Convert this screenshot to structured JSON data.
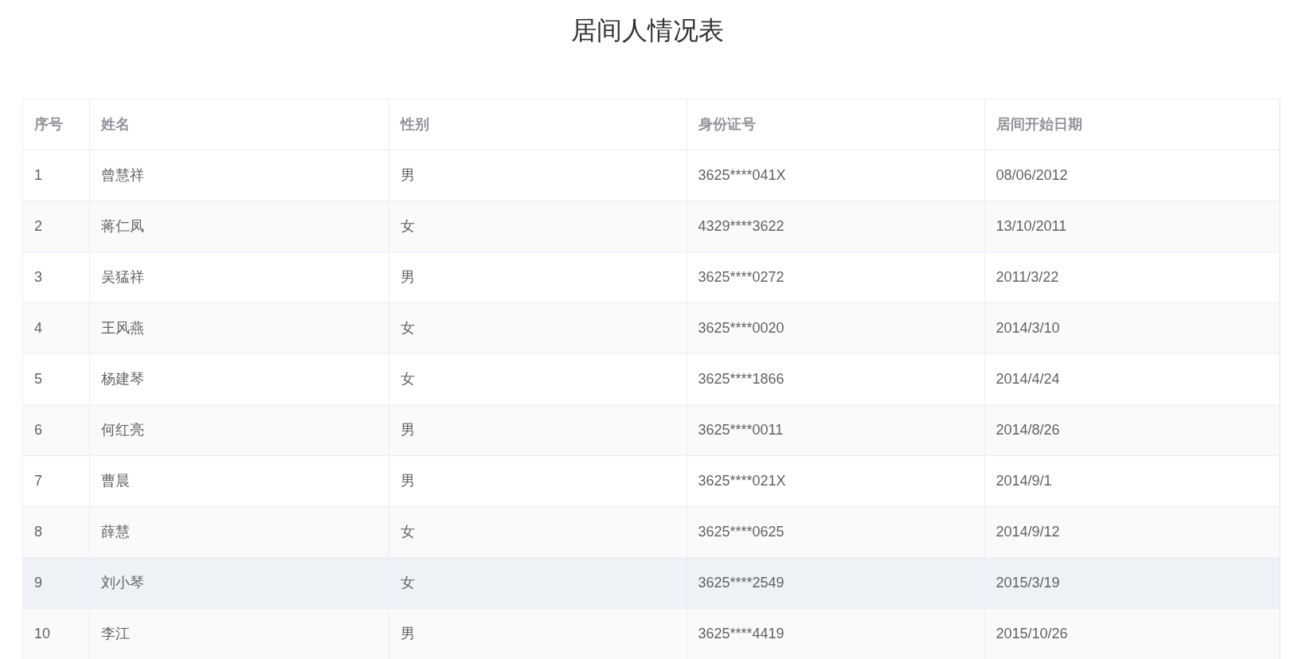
{
  "title": "居间人情况表",
  "table": {
    "columns": [
      "序号",
      "姓名",
      "性别",
      "身份证号",
      "居间开始日期"
    ],
    "rows": [
      {
        "cells": [
          "1",
          "曾慧祥",
          "男",
          "3625****041X",
          "08/06/2012"
        ],
        "selected": false
      },
      {
        "cells": [
          "2",
          "蒋仁凤",
          "女",
          "4329****3622",
          "13/10/2011"
        ],
        "selected": false
      },
      {
        "cells": [
          "3",
          "吴猛祥",
          "男",
          "3625****0272",
          "2011/3/22"
        ],
        "selected": false
      },
      {
        "cells": [
          "4",
          "王风燕",
          "女",
          "3625****0020",
          "2014/3/10"
        ],
        "selected": false
      },
      {
        "cells": [
          "5",
          "杨建琴",
          "女",
          "3625****1866",
          "2014/4/24"
        ],
        "selected": false
      },
      {
        "cells": [
          "6",
          "何红亮",
          "男",
          "3625****0011",
          "2014/8/26"
        ],
        "selected": false
      },
      {
        "cells": [
          "7",
          "曹晨",
          "男",
          "3625****021X",
          "2014/9/1"
        ],
        "selected": false
      },
      {
        "cells": [
          "8",
          "薛慧",
          "女",
          "3625****0625",
          "2014/9/12"
        ],
        "selected": false
      },
      {
        "cells": [
          "9",
          "刘小琴",
          "女",
          "3625****2549",
          "2015/3/19"
        ],
        "selected": true
      },
      {
        "cells": [
          "10",
          "李江",
          "男",
          "3625****4419",
          "2015/10/26"
        ],
        "selected": false
      }
    ]
  }
}
